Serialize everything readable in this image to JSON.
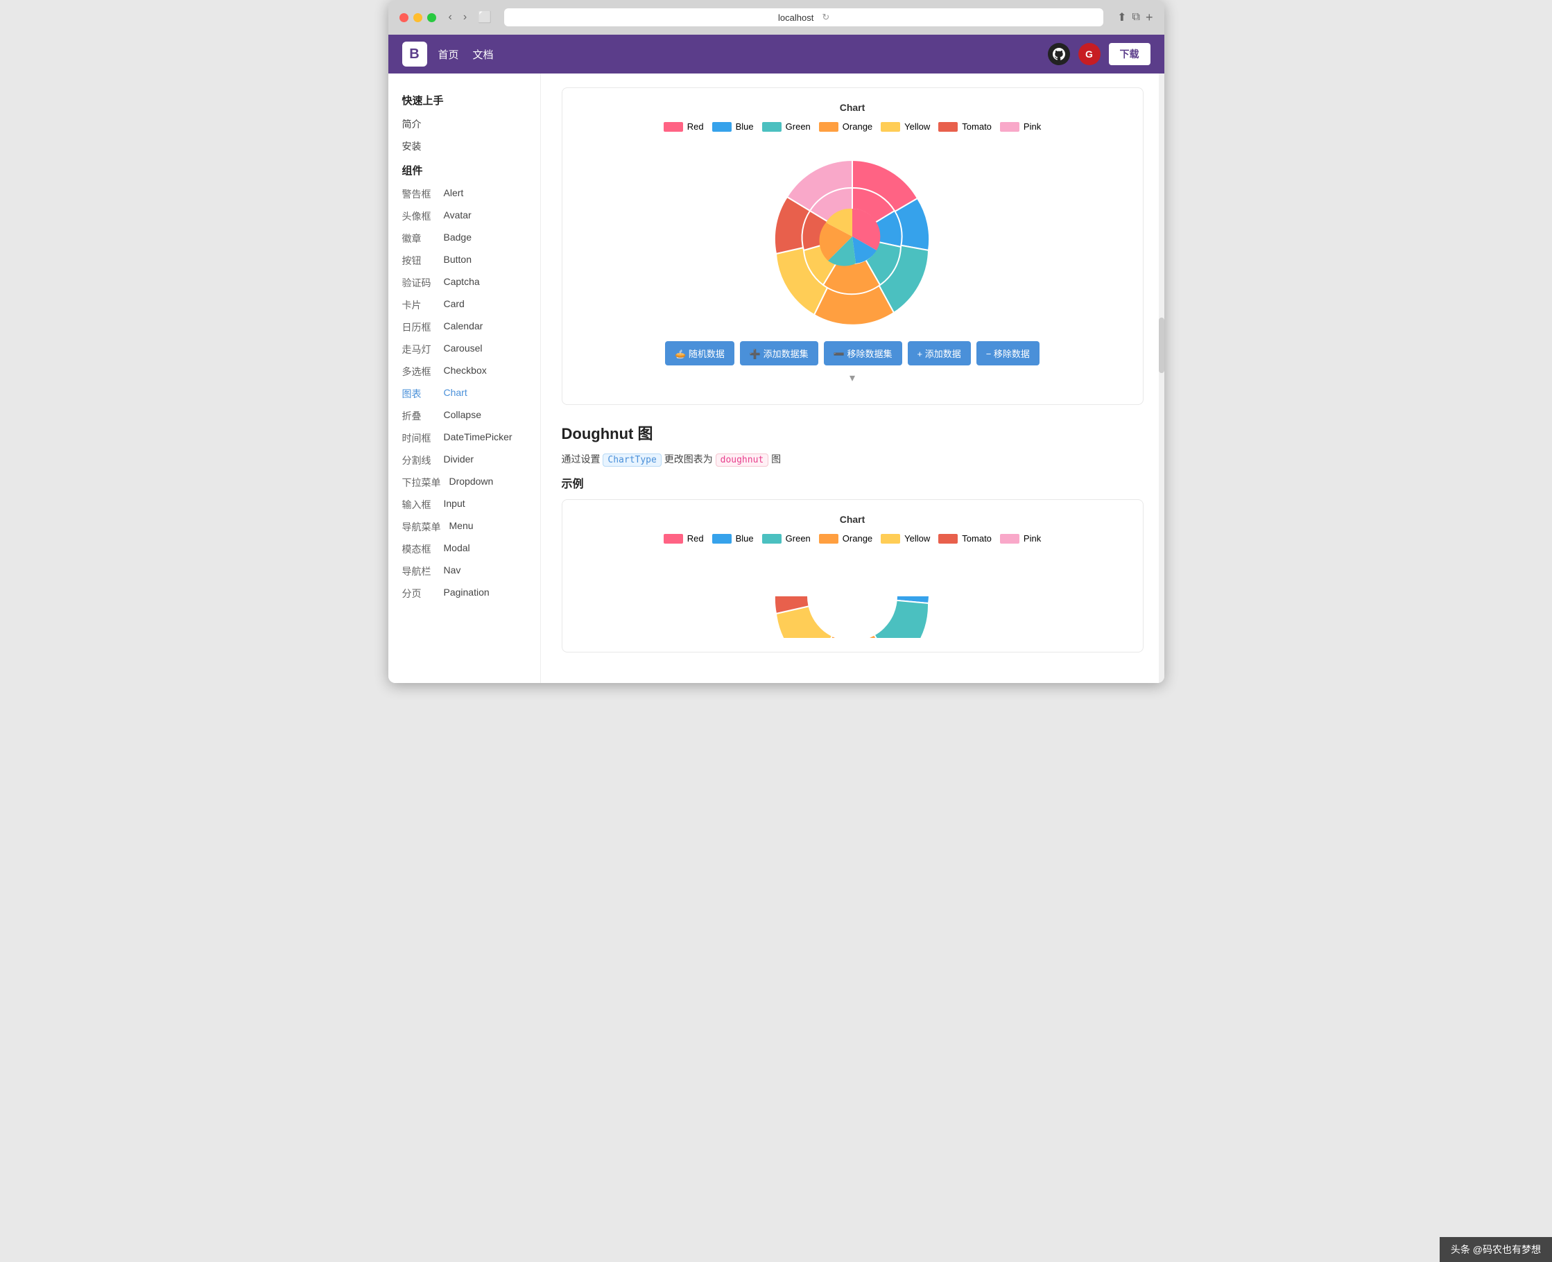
{
  "browser": {
    "url": "localhost",
    "reload_icon": "↻",
    "share_icon": "⬆",
    "window_icon": "⧉",
    "add_tab": "+",
    "back": "‹",
    "forward": "›",
    "sidebar": "⬛"
  },
  "header": {
    "logo": "B",
    "nav": [
      "首页",
      "文档"
    ],
    "download_label": "下载",
    "github_label": "G",
    "gitee_label": "G"
  },
  "sidebar": {
    "section1": "快速上手",
    "items_top": [
      "简介",
      "安装"
    ],
    "section2": "组件",
    "items": [
      {
        "zh": "警告框",
        "en": "Alert"
      },
      {
        "zh": "头像框",
        "en": "Avatar"
      },
      {
        "zh": "徽章",
        "en": "Badge"
      },
      {
        "zh": "按钮",
        "en": "Button"
      },
      {
        "zh": "验证码",
        "en": "Captcha"
      },
      {
        "zh": "卡片",
        "en": "Card"
      },
      {
        "zh": "日历框",
        "en": "Calendar"
      },
      {
        "zh": "走马灯",
        "en": "Carousel"
      },
      {
        "zh": "多选框",
        "en": "Checkbox"
      },
      {
        "zh": "图表",
        "en": "Chart",
        "active": true
      },
      {
        "zh": "折叠",
        "en": "Collapse"
      },
      {
        "zh": "时间框",
        "en": "DateTimePicker"
      },
      {
        "zh": "分割线",
        "en": "Divider"
      },
      {
        "zh": "下拉菜单",
        "en": "Dropdown"
      },
      {
        "zh": "输入框",
        "en": "Input"
      },
      {
        "zh": "导航菜单",
        "en": "Menu"
      },
      {
        "zh": "模态框",
        "en": "Modal"
      },
      {
        "zh": "导航栏",
        "en": "Nav"
      },
      {
        "zh": "分页",
        "en": "Pagination"
      }
    ]
  },
  "chart1": {
    "title": "Chart",
    "legend": [
      {
        "label": "Red",
        "color": "#ff6384"
      },
      {
        "label": "Blue",
        "color": "#36a2eb"
      },
      {
        "label": "Green",
        "color": "#4bc0c0"
      },
      {
        "label": "Orange",
        "color": "#ff9f40"
      },
      {
        "label": "Yellow",
        "color": "#ffcd56"
      },
      {
        "label": "Tomato",
        "color": "#e8604c"
      },
      {
        "label": "Pink",
        "color": "#f9a8c9"
      }
    ],
    "controls": [
      {
        "icon": "🥧",
        "label": "随机数据"
      },
      {
        "icon": "➕",
        "label": "添加数据集"
      },
      {
        "icon": "➖",
        "label": "移除数据集"
      },
      {
        "icon": "+",
        "label": "添加数据"
      },
      {
        "icon": "−",
        "label": "移除数据"
      }
    ]
  },
  "doughnut_section": {
    "title": "Doughnut 图",
    "desc_pre": "通过设置",
    "code1": "ChartType",
    "desc_mid": "更改图表为",
    "code2": "doughnut",
    "desc_post": "图",
    "example_label": "示例"
  },
  "chart2": {
    "title": "Chart",
    "legend": [
      {
        "label": "Red",
        "color": "#ff6384"
      },
      {
        "label": "Blue",
        "color": "#36a2eb"
      },
      {
        "label": "Green",
        "color": "#4bc0c0"
      },
      {
        "label": "Orange",
        "color": "#ff9f40"
      },
      {
        "label": "Yellow",
        "color": "#ffcd56"
      },
      {
        "label": "Tomato",
        "color": "#e8604c"
      },
      {
        "label": "Pink",
        "color": "#f9a8c9"
      }
    ]
  },
  "watermark": "头条 @码农也有梦想"
}
